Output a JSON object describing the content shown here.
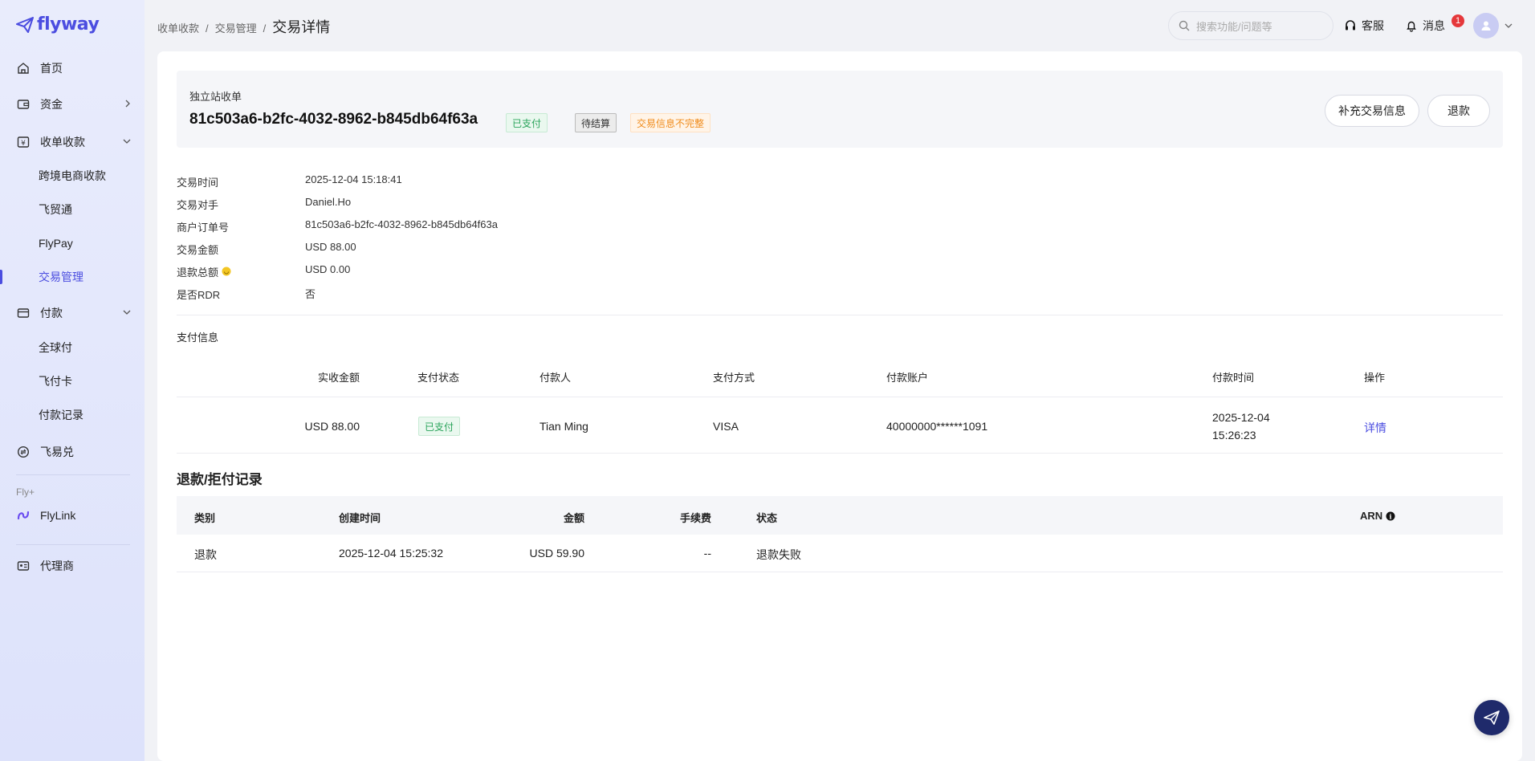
{
  "app": {
    "logo_text": "flyway",
    "brand_color": "#4b4de0"
  },
  "sidebar": {
    "items": [
      {
        "label": "首页",
        "icon": "home-icon"
      },
      {
        "label": "资金",
        "icon": "wallet-icon"
      },
      {
        "label": "收单收款",
        "icon": "yuan-box-icon"
      },
      {
        "label": "付款",
        "icon": "card-icon"
      },
      {
        "label": "飞易兑",
        "icon": "exchange-icon"
      }
    ],
    "collect_sub": [
      "跨境电商收款",
      "飞贸通",
      "FlyPay",
      "交易管理"
    ],
    "pay_sub": [
      "全球付",
      "飞付卡",
      "付款记录"
    ],
    "group_label": "Fly+",
    "flylink": "FlyLink",
    "agent": "代理商"
  },
  "header": {
    "breadcrumb": [
      "收单收款",
      "交易管理",
      "交易详情"
    ],
    "search_placeholder": "搜索功能/问题等",
    "service": "客服",
    "messages": "消息",
    "message_count": "1"
  },
  "summary": {
    "kind": "独立站收单",
    "txid": "81c503a6-b2fc-4032-8962-b845db64f63a",
    "tags": [
      "已支付",
      "待结算",
      "交易信息不完整"
    ],
    "buttons": {
      "supplement": "补充交易信息",
      "refund": "退款"
    }
  },
  "details": [
    {
      "label": "交易时间",
      "value": "2025-12-04 15:18:41"
    },
    {
      "label": "交易对手",
      "value": "Daniel.Ho"
    },
    {
      "label": "商户订单号",
      "value": "81c503a6-b2fc-4032-8962-b845db64f63a"
    },
    {
      "label": "交易金额",
      "value": "USD 88.00"
    },
    {
      "label": "退款总额",
      "value": "USD 0.00"
    },
    {
      "label": "是否RDR",
      "value": "否"
    }
  ],
  "payment": {
    "title": "支付信息",
    "headers": [
      "实收金额",
      "支付状态",
      "付款人",
      "支付方式",
      "付款账户",
      "付款时间",
      "操作"
    ],
    "row": {
      "amount": "USD 88.00",
      "status": "已支付",
      "payer": "Tian Ming",
      "method": "VISA",
      "account": "40000000******1091",
      "date": "2025-12-04",
      "time": "15:26:23",
      "action": "详情"
    }
  },
  "refunds": {
    "title": "退款/拒付记录",
    "headers": [
      "类别",
      "创建时间",
      "金额",
      "手续费",
      "状态",
      "ARN"
    ],
    "rows": [
      {
        "type": "退款",
        "created": "2025-12-04 15:25:32",
        "amount": "USD 59.90",
        "fee": "--",
        "status": "退款失败"
      }
    ]
  }
}
